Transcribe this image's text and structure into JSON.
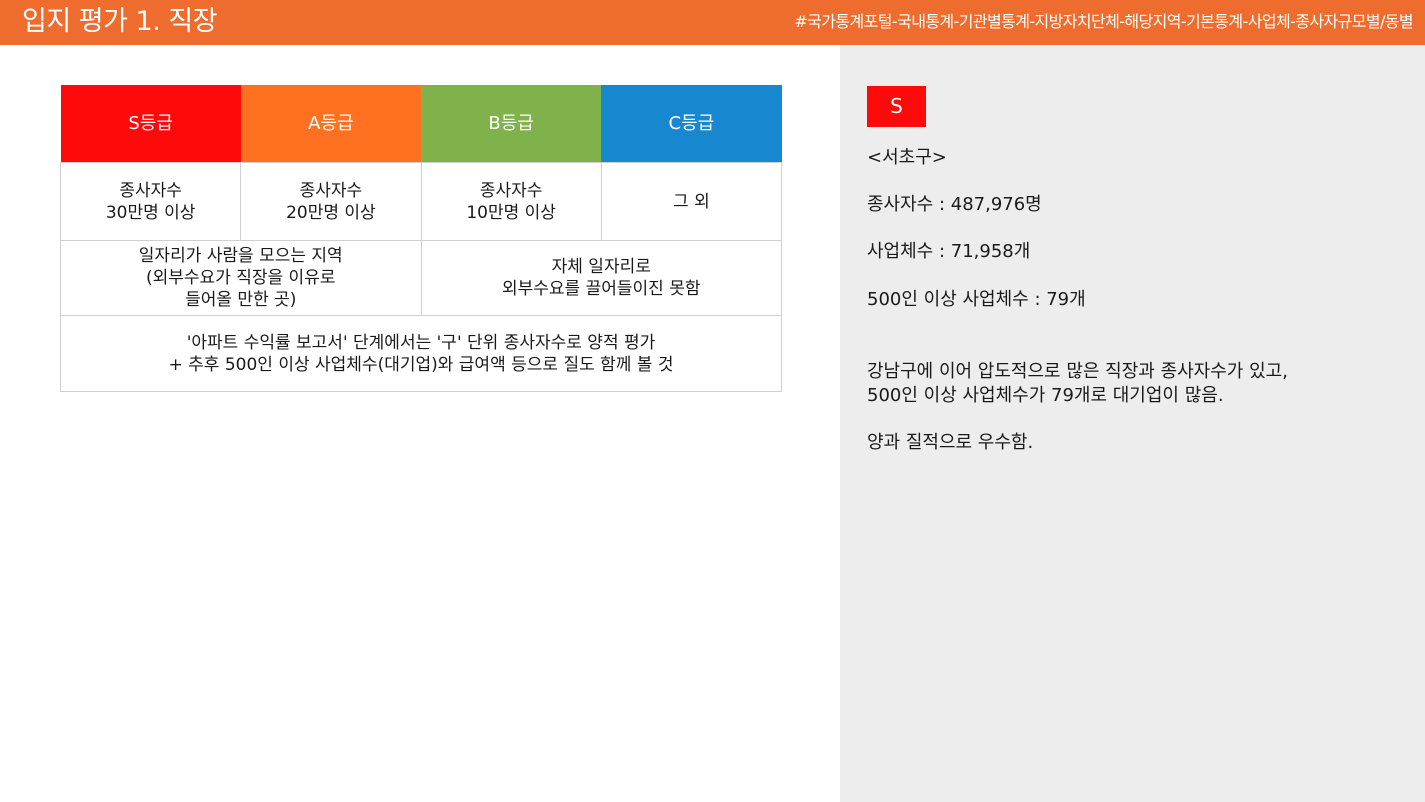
{
  "header": {
    "title": "입지 평가 1. 직장",
    "source": "#국가통계포털-국내통계-기관별통계-지방자치단체-해당지역-기본통계-사업체-종사자규모별/동별"
  },
  "grade_table": {
    "headers": [
      "S등급",
      "A등급",
      "B등급",
      "C등급"
    ],
    "criteria": [
      [
        "종사자수",
        "30만명 이상"
      ],
      [
        "종사자수",
        "20만명 이상"
      ],
      [
        "종사자수",
        "10만명 이상"
      ],
      [
        "그 외"
      ]
    ],
    "descriptions": [
      [
        "일자리가 사람을 모으는 지역",
        "(외부수요가 직장을 이유로",
        "들어올 만한 곳)"
      ],
      [
        "자체 일자리로",
        "외부수요를 끌어들이진 못함"
      ]
    ],
    "note": [
      "'아파트 수익률 보고서' 단계에서는 '구' 단위 종사자수로 양적 평가",
      "+ 추후 500인 이상 사업체수(대기업)와 급여액 등으로 질도 함께 볼 것"
    ]
  },
  "result": {
    "grade": "S",
    "district": "<서초구>",
    "employees": "종사자수 : 487,976명",
    "businesses": "사업체수 : 71,958개",
    "large_businesses": "500인 이상 사업체수 : 79개",
    "summary": [
      "강남구에 이어 압도적으로 많은 직장과 종사자수가 있고,",
      "500인 이상 사업체수가 79개로 대기업이 많음."
    ],
    "conclusion": "양과 질적으로 우수함."
  },
  "colors": {
    "header_bar": "#ee6c2d",
    "grade_s": "#ff0a0a",
    "grade_a": "#ff7121",
    "grade_b": "#7fb24a",
    "grade_c": "#1788d0",
    "panel": "#ededed"
  }
}
